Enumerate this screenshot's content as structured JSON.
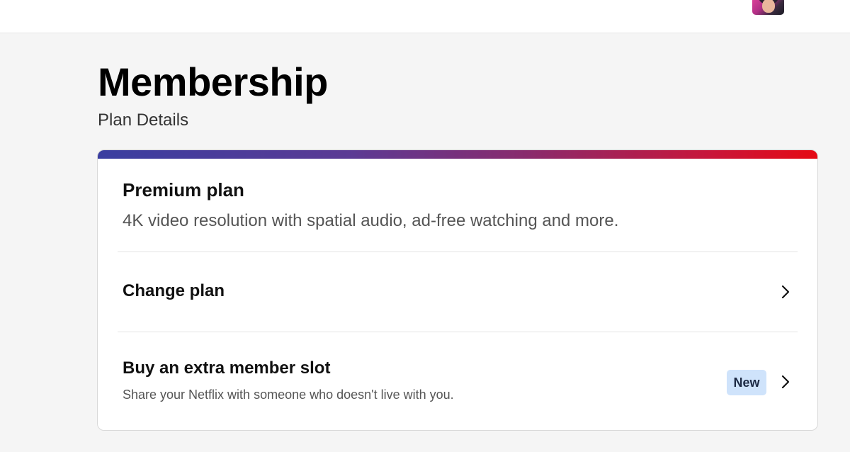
{
  "header": {
    "avatar_icon": "profile-avatar"
  },
  "page": {
    "title": "Membership",
    "subtitle": "Plan Details"
  },
  "plan_card": {
    "accent_colors": [
      "#3a3ea0",
      "#8a2a6c",
      "#e50914"
    ],
    "plan_name": "Premium plan",
    "plan_description": "4K video resolution with spatial audio, ad-free watching and more.",
    "rows": [
      {
        "label": "Change plan",
        "icon": "chevron-right-icon"
      },
      {
        "label": "Buy an extra member slot",
        "sublabel": "Share your Netflix with someone who doesn't live with you.",
        "badge": "New",
        "badge_color": "#cfe3fb",
        "icon": "chevron-right-icon"
      }
    ]
  }
}
